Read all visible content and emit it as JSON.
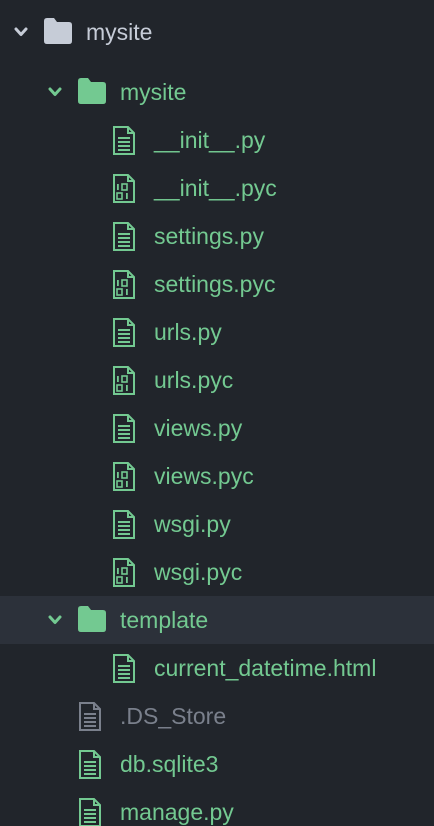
{
  "colors": {
    "background": "#21252b",
    "selected_row": "#2c313a",
    "added": "#73c991",
    "ignored": "#7a808c",
    "root": "#c6ccd7"
  },
  "tree": {
    "root": {
      "label": "mysite",
      "icon": "folder-icon",
      "expanded": true
    },
    "app_folder": {
      "label": "mysite",
      "icon": "folder-icon",
      "expanded": true
    },
    "app_files": [
      {
        "label": "__init__.py",
        "icon": "file-text-icon"
      },
      {
        "label": "__init__.pyc",
        "icon": "file-binary-icon"
      },
      {
        "label": "settings.py",
        "icon": "file-text-icon"
      },
      {
        "label": "settings.pyc",
        "icon": "file-binary-icon"
      },
      {
        "label": "urls.py",
        "icon": "file-text-icon"
      },
      {
        "label": "urls.pyc",
        "icon": "file-binary-icon"
      },
      {
        "label": "views.py",
        "icon": "file-text-icon"
      },
      {
        "label": "views.pyc",
        "icon": "file-binary-icon"
      },
      {
        "label": "wsgi.py",
        "icon": "file-text-icon"
      },
      {
        "label": "wsgi.pyc",
        "icon": "file-binary-icon"
      }
    ],
    "template_folder": {
      "label": "template",
      "icon": "folder-icon",
      "expanded": true,
      "selected": true
    },
    "template_files": [
      {
        "label": "current_datetime.html",
        "icon": "file-text-icon"
      }
    ],
    "root_files": [
      {
        "label": ".DS_Store",
        "icon": "file-text-icon",
        "status": "ignored"
      },
      {
        "label": "db.sqlite3",
        "icon": "file-text-icon",
        "status": "added"
      },
      {
        "label": "manage.py",
        "icon": "file-text-icon",
        "status": "added"
      }
    ]
  }
}
